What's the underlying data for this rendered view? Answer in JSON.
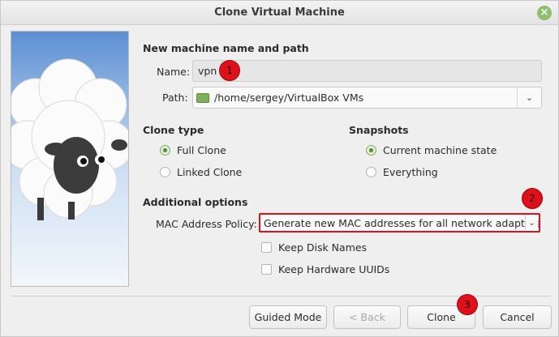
{
  "window": {
    "title": "Clone Virtual Machine"
  },
  "name_path": {
    "section_title": "New machine name and path",
    "name_label": "Name:",
    "name_value": "vpn",
    "path_label": "Path:",
    "path_value": "/home/sergey/VirtualBox VMs"
  },
  "clone_type": {
    "title": "Clone type",
    "options": [
      {
        "label": "Full Clone",
        "checked": true
      },
      {
        "label": "Linked Clone",
        "checked": false
      }
    ]
  },
  "snapshots": {
    "title": "Snapshots",
    "options": [
      {
        "label": "Current machine state",
        "checked": true
      },
      {
        "label": "Everything",
        "checked": false
      }
    ]
  },
  "additional": {
    "title": "Additional options",
    "mac_label": "MAC Address Policy:",
    "mac_value": "Generate new MAC addresses for all network adapters",
    "keep_disk_names": "Keep Disk Names",
    "keep_hw_uuids": "Keep Hardware UUIDs"
  },
  "buttons": {
    "guided": "Guided Mode",
    "back": "< Back",
    "clone": "Clone",
    "cancel": "Cancel"
  },
  "badges": [
    "1",
    "2",
    "3"
  ],
  "colors": {
    "accent": "#4f8f2f",
    "highlight": "#e0101a"
  }
}
